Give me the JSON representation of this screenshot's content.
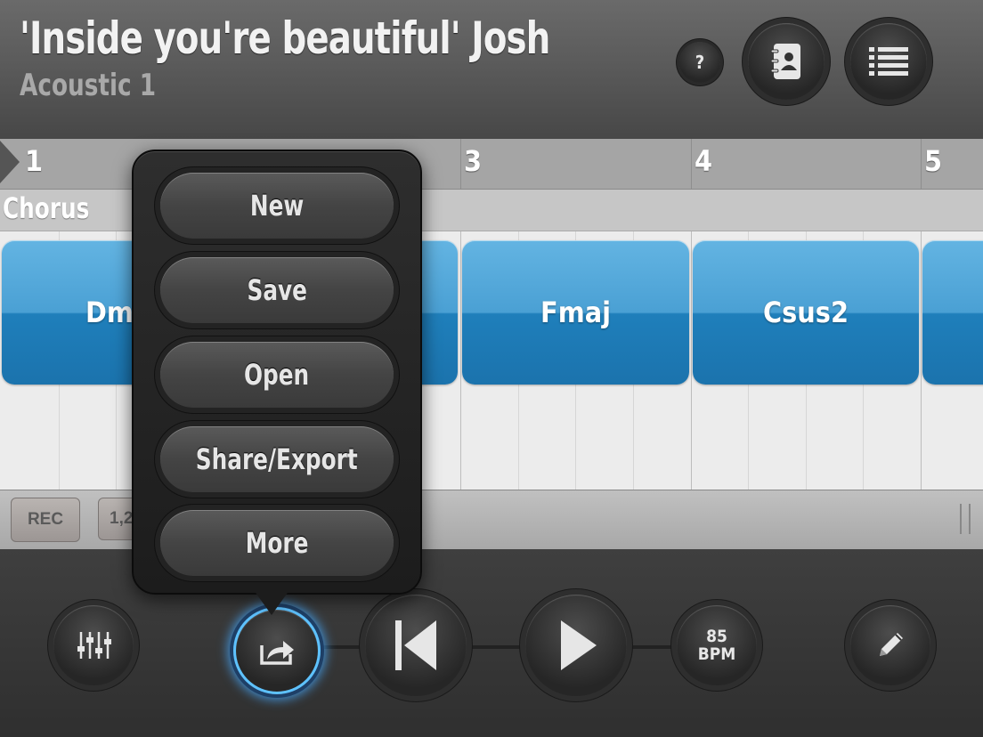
{
  "header": {
    "song_title": "'Inside you're beautiful' Josh",
    "song_subtitle": "Acoustic 1",
    "help_label": "?"
  },
  "ruler": {
    "bar_numbers": [
      "1",
      "3",
      "4",
      "5"
    ]
  },
  "section": {
    "label": "Chorus"
  },
  "chords": [
    "Dmi",
    "Fmaj",
    "Csus2"
  ],
  "track_bar": {
    "rec_label": "REC",
    "count_label": "1,2"
  },
  "popup_menu": {
    "items": [
      "New",
      "Save",
      "Open",
      "Share/Export",
      "More"
    ]
  },
  "transport": {
    "bpm_value": "85",
    "bpm_unit": "BPM"
  },
  "colors": {
    "chord_blue": "#3d9bd3",
    "share_glow": "#5ec2ff"
  },
  "icons": {
    "contacts": "address-book-icon",
    "list": "list-icon",
    "mixer": "mixer-sliders-icon",
    "share": "share-export-icon",
    "rewind": "skip-to-start-icon",
    "play": "play-icon",
    "edit": "pencil-icon"
  }
}
